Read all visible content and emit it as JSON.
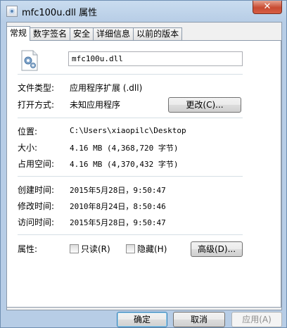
{
  "window": {
    "title": "mfc100u.dll 属性",
    "close_label": "✕"
  },
  "tabs": [
    {
      "label": "常规",
      "active": true
    },
    {
      "label": "数字签名",
      "active": false
    },
    {
      "label": "安全",
      "active": false
    },
    {
      "label": "详细信息",
      "active": false
    },
    {
      "label": "以前的版本",
      "active": false
    }
  ],
  "file": {
    "name": "mfc100u.dll",
    "icon": "dll-file-icon"
  },
  "rows": {
    "type": {
      "label": "文件类型:",
      "value": "应用程序扩展 (.dll)"
    },
    "opens_with": {
      "label": "打开方式:",
      "value": "未知应用程序",
      "button": "更改(C)..."
    },
    "location": {
      "label": "位置:",
      "value": "C:\\Users\\xiaopilc\\Desktop"
    },
    "size": {
      "label": "大小:",
      "value": "4.16 MB (4,368,720 字节)"
    },
    "size_on_disk": {
      "label": "占用空间:",
      "value": "4.16 MB (4,370,432 字节)"
    },
    "created": {
      "label": "创建时间:",
      "value": "2015年5月28日，9:50:47"
    },
    "modified": {
      "label": "修改时间:",
      "value": "2010年8月24日，8:50:46"
    },
    "accessed": {
      "label": "访问时间:",
      "value": "2015年5月28日，9:50:47"
    },
    "attributes": {
      "label": "属性:",
      "readonly": {
        "label": "只读(R)",
        "checked": false
      },
      "hidden": {
        "label": "隐藏(H)",
        "checked": false
      },
      "advanced_button": "高级(D)..."
    }
  },
  "footer": {
    "ok": "确定",
    "cancel": "取消",
    "apply": "应用(A)"
  }
}
